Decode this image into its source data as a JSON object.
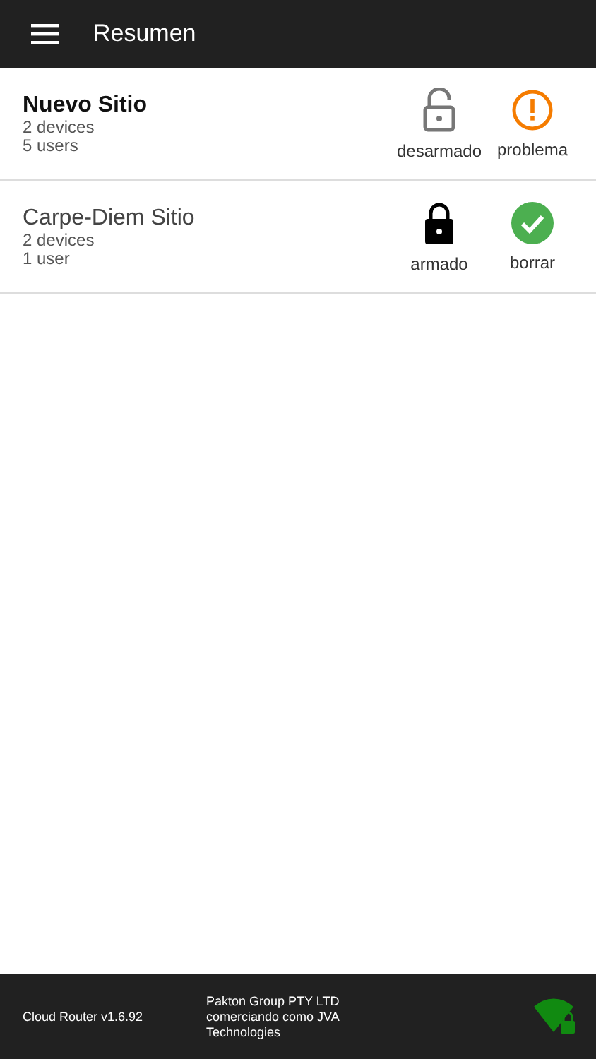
{
  "app_bar": {
    "title": "Resumen"
  },
  "sites": [
    {
      "name": "Nuevo Sitio",
      "emphasized": true,
      "devices": "2 devices",
      "users": "5 users",
      "arm": {
        "kind": "unlocked",
        "label": "desarmado"
      },
      "status": {
        "kind": "warning",
        "label": "problema"
      }
    },
    {
      "name": "Carpe-Diem Sitio",
      "emphasized": false,
      "devices": "2 devices",
      "users": "1 user",
      "arm": {
        "kind": "locked",
        "label": "armado"
      },
      "status": {
        "kind": "ok",
        "label": "borrar"
      }
    }
  ],
  "footer": {
    "version": "Cloud Router v1.6.92",
    "company": "Pakton Group PTY LTD comerciando como JVA Technologies"
  }
}
